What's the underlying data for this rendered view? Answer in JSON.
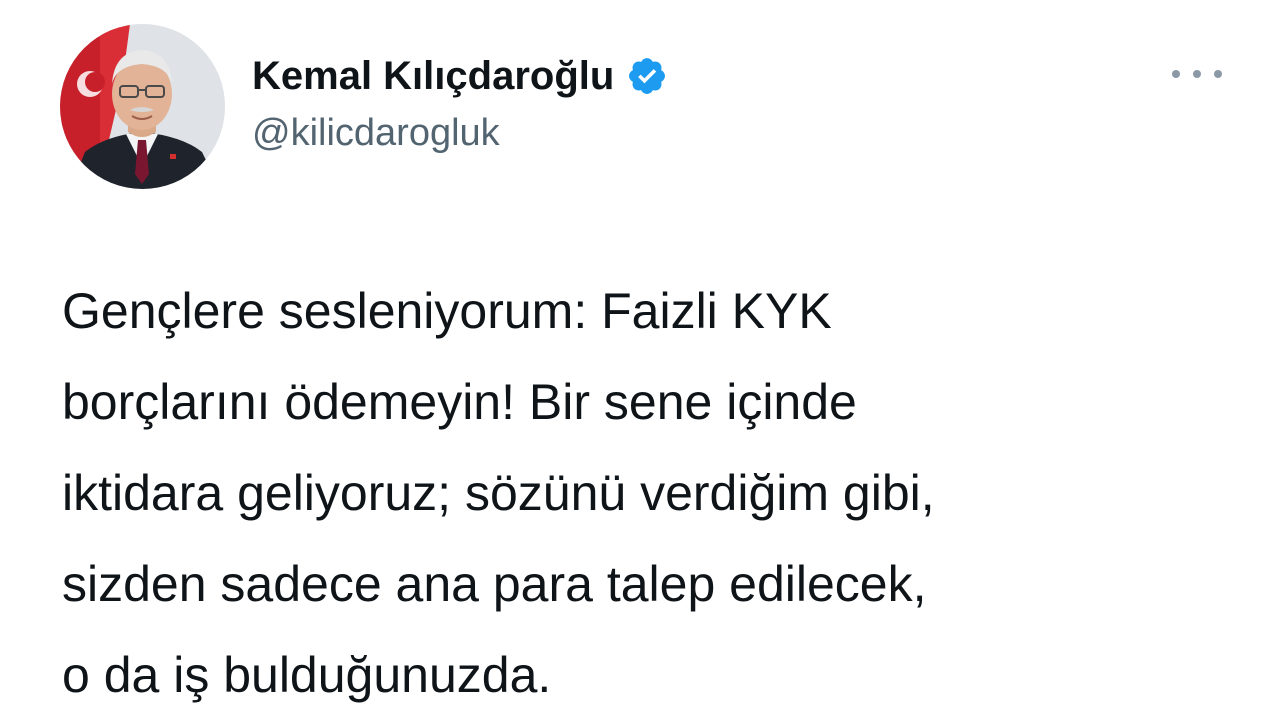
{
  "tweet": {
    "author": {
      "display_name": "Kemal Kılıçdaroğlu",
      "handle": "@kilicdarogluk",
      "verified": true,
      "verified_icon": "verified-badge-icon",
      "verified_color": "#1d9bf0"
    },
    "more_icon": "more-horizontal-icon",
    "text_lines": [
      "Gençlere sesleniyorum: Faizli KYK",
      "borçlarını ödemeyin! Bir sene içinde",
      "iktidara geliyoruz; sözünü verdiğim gibi,",
      "sizden sadece ana para talep edilecek,",
      "o da iş bulduğunuzda."
    ]
  }
}
